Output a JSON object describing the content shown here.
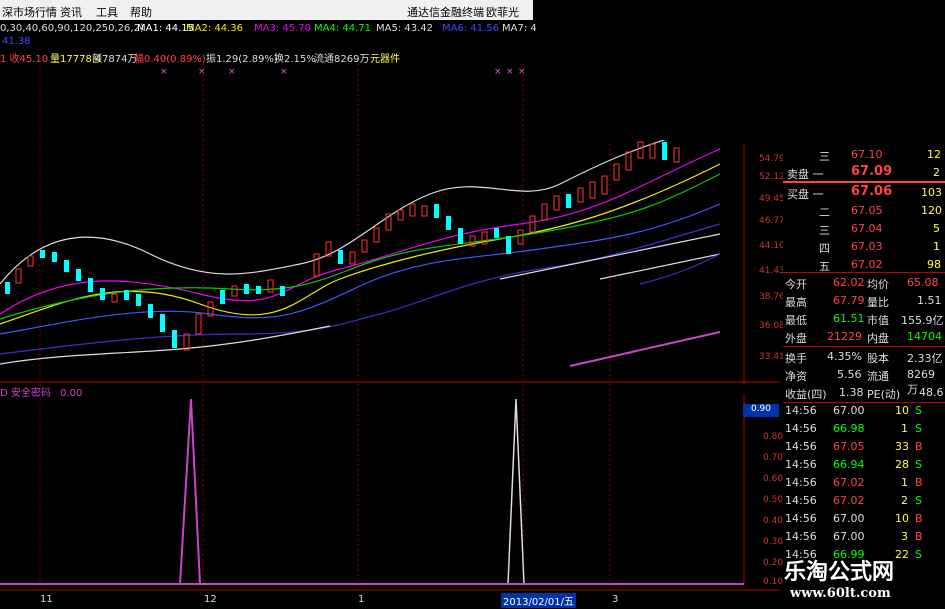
{
  "menu": {
    "market": "深市场行情",
    "info": "资讯",
    "tools": "工具",
    "help": "帮助",
    "brand": "通达信金融终端",
    "user": "欧菲光"
  },
  "ma_bar": {
    "params": "0,30,40,60,90,120,250,26,2)",
    "ma1": "MA1: 44.15",
    "ma2": "MA2: 44.36",
    "ma3": "MA3: 45.70",
    "ma4": "MA4: 44.71",
    "ma5": "MA5: 43.42",
    "ma6": "MA6: 41.56",
    "ma7": "MA7: 4"
  },
  "quote_header": {
    "left": "1 收45.10",
    "vol": "量17778.4",
    "amount": "额7874万",
    "change": "幅0.40(0.89%)",
    "amp": "振1.29(2.89%)",
    "turn": "换2.15%",
    "float": "流通8269万",
    "sector": "元器件"
  },
  "partial_top": "41.38",
  "price_axis": [
    "54.79",
    "52.12",
    "49.45",
    "46.77",
    "44.10",
    "41.43",
    "38.76",
    "36.08",
    "33.41"
  ],
  "indicator": {
    "name": "安全密码",
    "value": "0.00",
    "axis": [
      "0.90",
      "0.80",
      "0.70",
      "0.60",
      "0.50",
      "0.40",
      "0.30",
      "0.20",
      "0.10"
    ]
  },
  "date_axis": {
    "m11": "11",
    "m12": "12",
    "m1": "1",
    "date": "2013/02/01/五",
    "m3": "3"
  },
  "order_book": {
    "sell3_label": "三",
    "sell3_price": "67.10",
    "sell3_vol": "12",
    "sell1_label": "卖盘 一",
    "sell1_price": "67.09",
    "sell1_vol": "2",
    "buy1_label": "买盘 一",
    "buy1_price": "67.06",
    "buy1_vol": "103",
    "buy2_label": "二",
    "buy2_price": "67.05",
    "buy2_vol": "120",
    "buy3_label": "三",
    "buy3_price": "67.04",
    "buy3_vol": "5",
    "buy4_label": "四",
    "buy4_price": "67.03",
    "buy4_vol": "1",
    "buy5_label": "五",
    "buy5_price": "67.02",
    "buy5_vol": "98"
  },
  "stats": [
    {
      "l1": "今开",
      "v1": "62.02",
      "l2": "均价",
      "v2": "65.08"
    },
    {
      "l1": "最高",
      "v1": "67.79",
      "l2": "量比",
      "v2": "1.51"
    },
    {
      "l1": "最低",
      "v1": "61.51",
      "l2": "市值",
      "v2": "155.9亿"
    },
    {
      "l1": "外盘",
      "v1": "21229",
      "l2": "内盘",
      "v2": "14704"
    },
    {
      "l1": "换手",
      "v1": "4.35%",
      "l2": "股本",
      "v2": "2.33亿"
    },
    {
      "l1": "净资",
      "v1": "5.56",
      "l2": "流通",
      "v2": "8269万"
    },
    {
      "l1": "收益(四)",
      "v1": "1.38",
      "l2": "PE(动)",
      "v2": "48.6"
    }
  ],
  "ticks": [
    {
      "t": "14:56",
      "p": "67.00",
      "v": "10",
      "s": "S"
    },
    {
      "t": "14:56",
      "p": "66.98",
      "v": "1",
      "s": "S"
    },
    {
      "t": "14:56",
      "p": "67.05",
      "v": "33",
      "s": "B"
    },
    {
      "t": "14:56",
      "p": "66.94",
      "v": "28",
      "s": "S"
    },
    {
      "t": "14:56",
      "p": "67.02",
      "v": "1",
      "s": "B"
    },
    {
      "t": "14:56",
      "p": "67.02",
      "v": "2",
      "s": "S"
    },
    {
      "t": "14:56",
      "p": "67.00",
      "v": "10",
      "s": "B"
    },
    {
      "t": "14:56",
      "p": "67.00",
      "v": "3",
      "s": "B"
    },
    {
      "t": "14:56",
      "p": "66.99",
      "v": "22",
      "s": "S"
    }
  ],
  "watermark": {
    "cn": "乐淘公式网",
    "url": "www.60lt.com"
  },
  "colors": {
    "up": "#ff3333",
    "down": "#00ffff",
    "axis": "#bb0000",
    "indicator": "#cc66cc"
  }
}
